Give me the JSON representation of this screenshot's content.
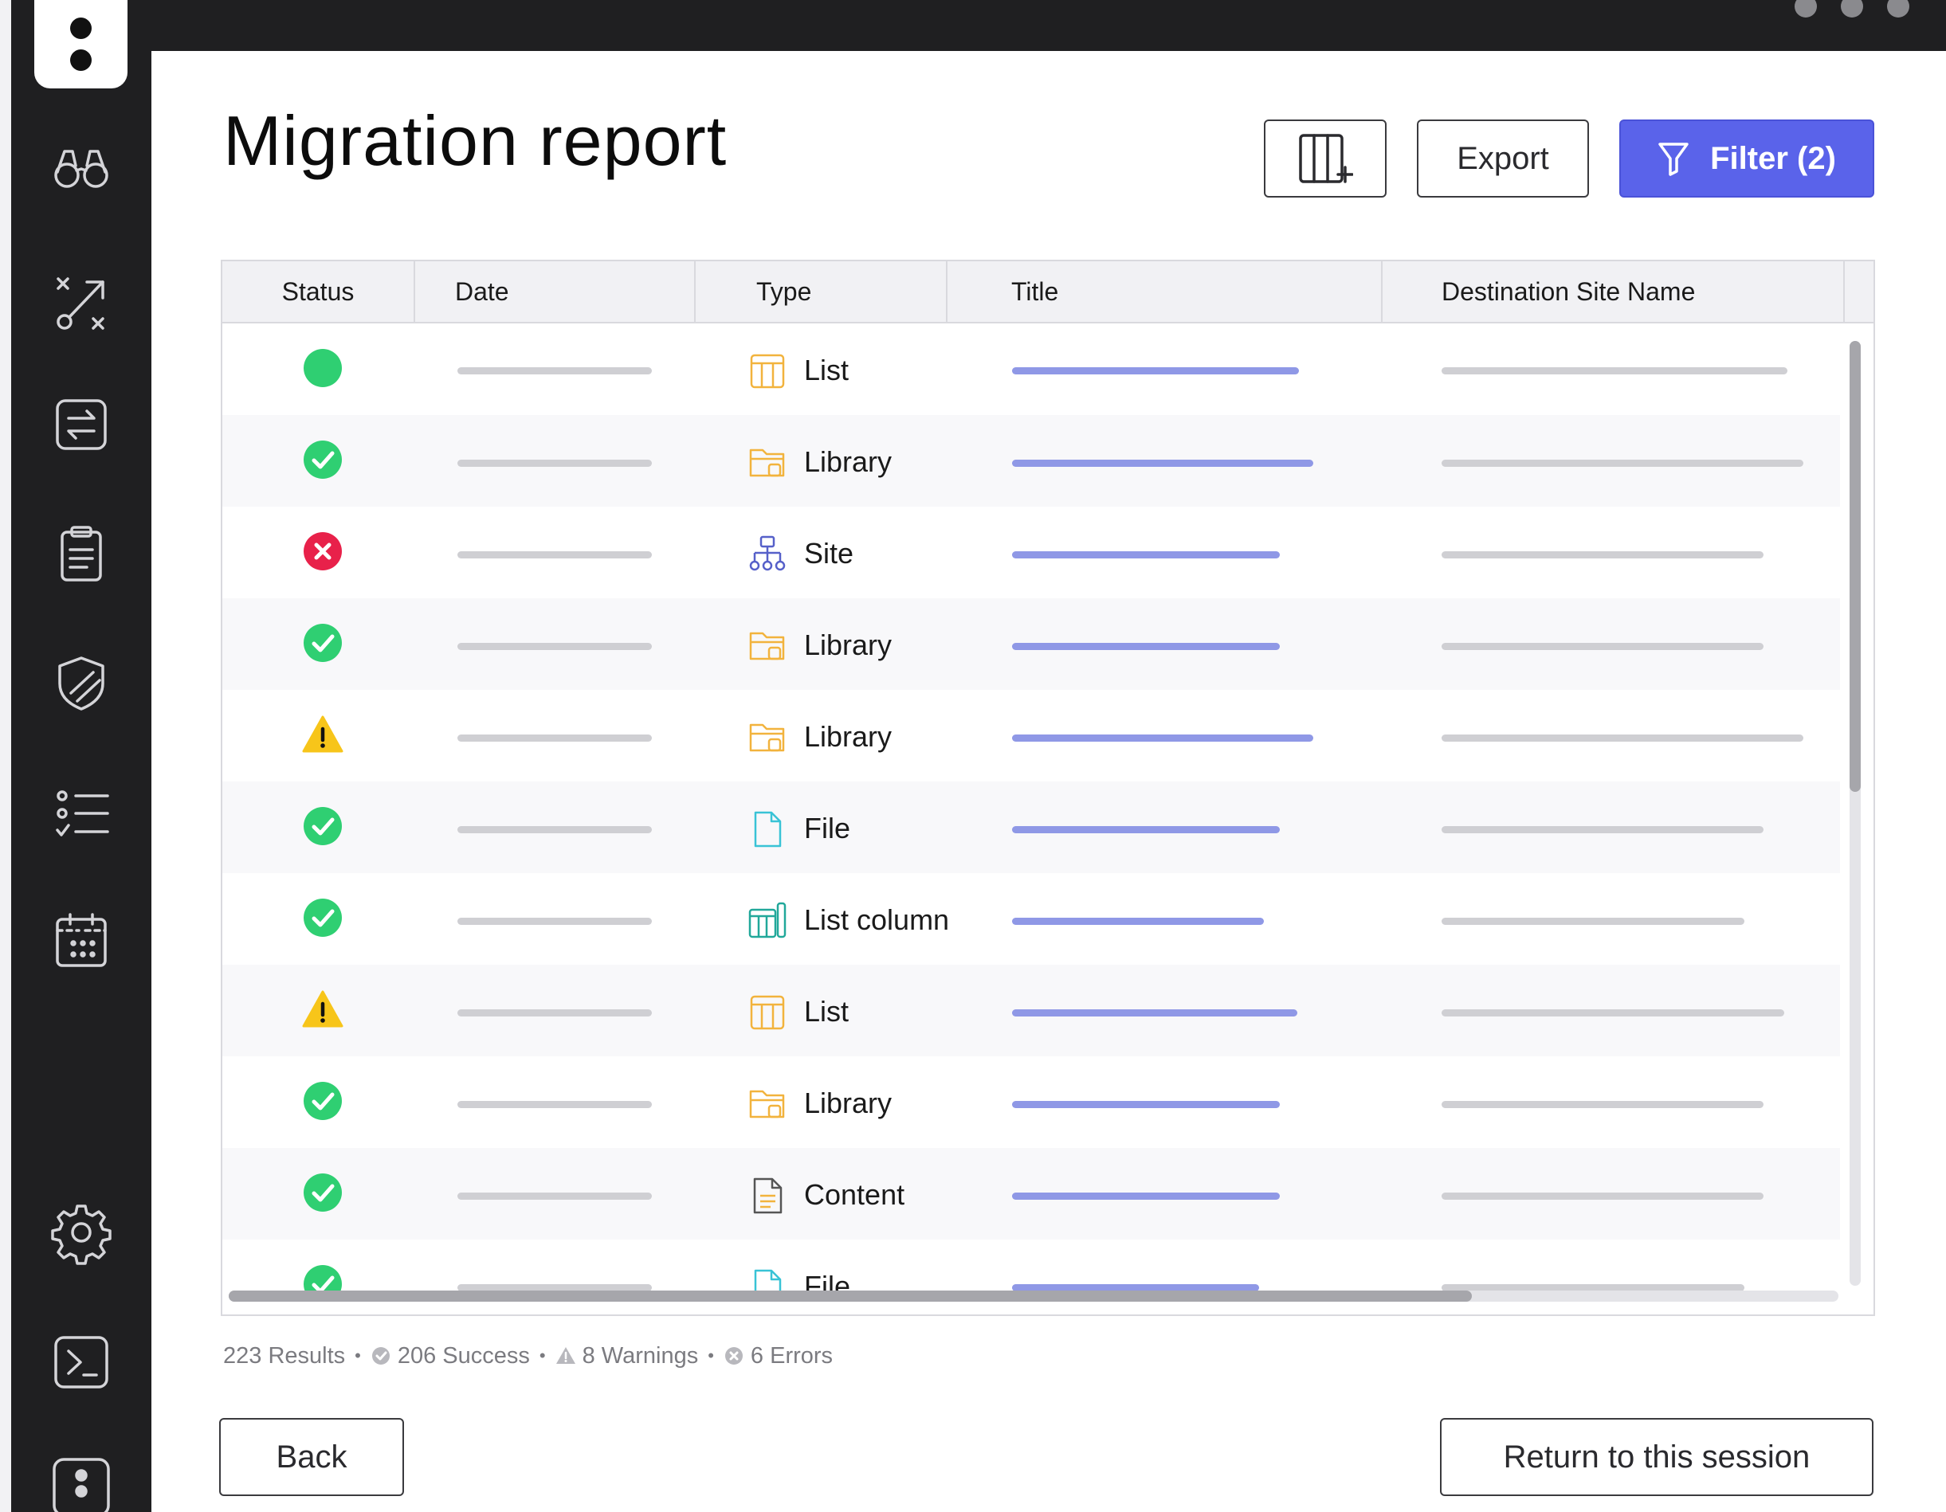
{
  "app": {
    "colors": {
      "accent": "#5a63ea",
      "success": "#2fcf72",
      "error": "#e8214a",
      "warning": "#f7c51a",
      "sidebar": "#1f1f21"
    }
  },
  "sidebar": {
    "logo_icon": "app-logo",
    "items": [
      {
        "icon": "binoculars-icon"
      },
      {
        "icon": "route-icon"
      },
      {
        "icon": "transfer-icon"
      },
      {
        "icon": "clipboard-icon"
      },
      {
        "icon": "shield-icon"
      },
      {
        "icon": "checklist-icon"
      },
      {
        "icon": "calendar-icon"
      },
      {
        "icon": "gear-icon"
      },
      {
        "icon": "terminal-icon"
      },
      {
        "icon": "app-logo-icon"
      }
    ]
  },
  "header": {
    "title": "Migration report",
    "columns_button_icon": "add-column-icon",
    "export_label": "Export",
    "filter_label": "Filter (2)",
    "filter_icon": "filter-icon"
  },
  "table": {
    "columns": [
      "Status",
      "Date",
      "Type",
      "Title",
      "Destination Site Name"
    ],
    "rows": [
      {
        "status": "success-dot",
        "type": "List",
        "type_icon": "list-icon"
      },
      {
        "status": "success",
        "type": "Library",
        "type_icon": "library-icon"
      },
      {
        "status": "error",
        "type": "Site",
        "type_icon": "site-icon"
      },
      {
        "status": "success",
        "type": "Library",
        "type_icon": "library-icon"
      },
      {
        "status": "warning",
        "type": "Library",
        "type_icon": "library-icon"
      },
      {
        "status": "success",
        "type": "File",
        "type_icon": "file-icon"
      },
      {
        "status": "success",
        "type": "List column",
        "type_icon": "list-column-icon"
      },
      {
        "status": "warning",
        "type": "List",
        "type_icon": "list-icon"
      },
      {
        "status": "success",
        "type": "Library",
        "type_icon": "library-icon"
      },
      {
        "status": "success",
        "type": "Content",
        "type_icon": "content-icon"
      },
      {
        "status": "success",
        "type": "File",
        "type_icon": "file-icon"
      }
    ]
  },
  "summary": {
    "results": "223 Results",
    "success": "206 Success",
    "warnings": "8 Warnings",
    "errors": "6 Errors"
  },
  "footer": {
    "back_label": "Back",
    "return_label": "Return to this session"
  }
}
